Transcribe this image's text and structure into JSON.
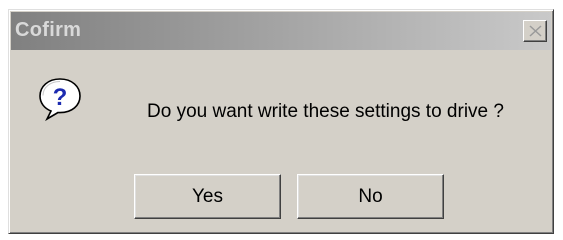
{
  "dialog": {
    "title": "Cofirm",
    "close_icon": "close-icon",
    "icon": "question-icon",
    "icon_glyph": "?",
    "message": "Do you want write these settings to drive ?",
    "buttons": {
      "yes_label": "Yes",
      "no_label": "No"
    }
  },
  "colors": {
    "face": "#d4d0c8",
    "titlebar_start": "#808080",
    "titlebar_end": "#c9c9c9",
    "title_text": "#d9d9d9",
    "question_mark": "#1c2bb0"
  }
}
